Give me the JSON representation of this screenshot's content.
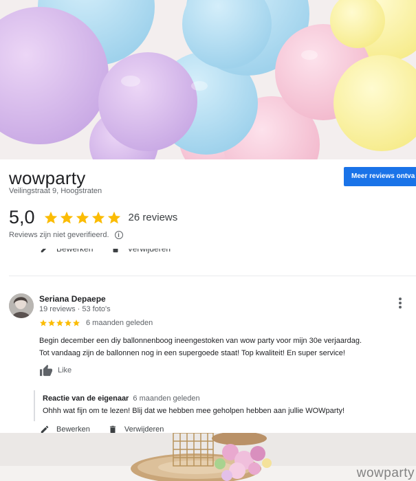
{
  "business": {
    "name": "wowparty",
    "address": "Veilingstraat 9, Hoogstraten",
    "more_reviews_button": "Meer reviews ontva",
    "rating": "5,0",
    "review_count": "26 reviews",
    "verified_note": "Reviews zijn niet geverifieerd.",
    "info_icon": "i"
  },
  "actions": {
    "edit_label": "Bewerken",
    "delete_label": "Verwijderen"
  },
  "review": {
    "author": "Seriana Depaepe",
    "meta": "19 reviews · 53 foto's",
    "rating": 5,
    "date": "6 maanden geleden",
    "text_line1": "Begin december een diy ballonnenboog ineengestoken van wow party voor mijn 30e verjaardag.",
    "text_line2": "Tot vandaag zijn de ballonnen nog in een supergoede staat! Top kwaliteit! En super service!",
    "like_label": "Like"
  },
  "owner_reply": {
    "title": "Reactie van de eigenaar",
    "date": "6 maanden geleden",
    "text": "Ohhh wat fijn om te lezen! Blij dat we hebben mee geholpen hebben aan jullie WOWparty!"
  },
  "watermark": "wowparty",
  "colors": {
    "star": "#fbbc04",
    "button": "#1a73e8",
    "divider": "#e8eaed"
  },
  "icons": {
    "star": "star-icon",
    "info": "info-icon",
    "more": "more-vert-icon",
    "like": "thumbs-up-icon",
    "edit": "pencil-icon",
    "delete": "trash-icon"
  }
}
